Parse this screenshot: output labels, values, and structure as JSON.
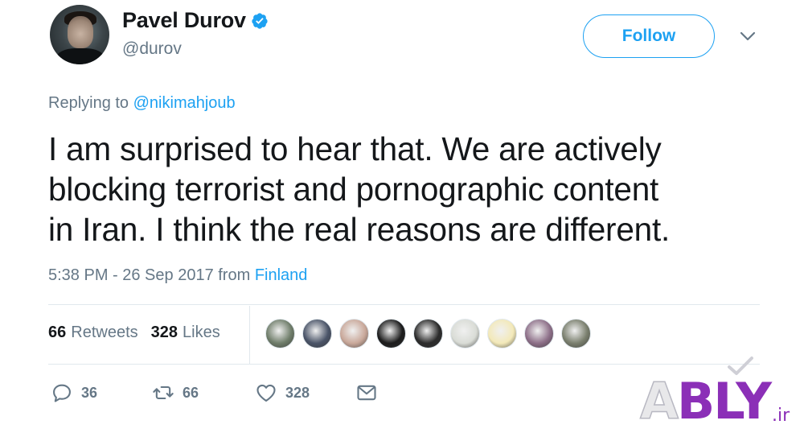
{
  "header": {
    "display_name": "Pavel Durov",
    "handle": "@durov",
    "follow_label": "Follow",
    "verified_icon": "verified-badge-icon",
    "more_icon": "chevron-down-icon"
  },
  "reply": {
    "prefix": "Replying to ",
    "mention": "@nikimahjoub"
  },
  "tweet": {
    "text": "I am surprised to hear that. We are actively\nblocking terrorist and pornographic content\nin Iran. I think the real reasons are different."
  },
  "meta": {
    "timestamp": "5:38 PM - 26 Sep 2017 from ",
    "location": "Finland"
  },
  "stats": {
    "retweets_count": "66",
    "retweets_label": "Retweets",
    "likes_count": "328",
    "likes_label": "Likes"
  },
  "likers": [
    {
      "name": "liker-avatar-1",
      "color": "#6f7d6a"
    },
    {
      "name": "liker-avatar-2",
      "color": "#4a5468"
    },
    {
      "name": "liker-avatar-3",
      "color": "#c9a89a"
    },
    {
      "name": "liker-avatar-4",
      "color": "#1c1c1c"
    },
    {
      "name": "liker-avatar-5",
      "color": "#2b2b2b"
    },
    {
      "name": "liker-avatar-6",
      "color": "#d9dcd6"
    },
    {
      "name": "liker-avatar-7",
      "color": "#f3e9b9"
    },
    {
      "name": "liker-avatar-8",
      "color": "#8d6f88"
    },
    {
      "name": "liker-avatar-9",
      "color": "#7a7f6e"
    }
  ],
  "actions": {
    "reply_count": "36",
    "retweet_count": "66",
    "like_count": "328"
  },
  "watermark": {
    "part1": "A",
    "part2": "BLY",
    "suffix": ".ir"
  },
  "colors": {
    "accent": "#1da1f2",
    "secondary_text": "#657786",
    "primary_text": "#14171a",
    "watermark_purple": "#8b2fb7"
  }
}
